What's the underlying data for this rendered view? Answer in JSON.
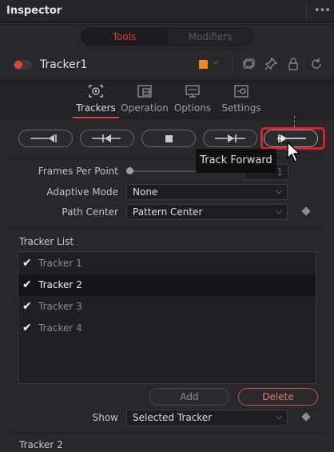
{
  "header": {
    "title": "Inspector",
    "menu_icon": "more-dots-icon"
  },
  "mode_toggle": {
    "tools_label": "Tools",
    "modifiers_label": "Modifiers",
    "selected": "Tools"
  },
  "node": {
    "name": "Tracker1",
    "enabled": true,
    "color": "#f08a1d"
  },
  "tabs": [
    {
      "label": "Trackers",
      "icon": "tracker-target-icon",
      "active": true
    },
    {
      "label": "Operation",
      "icon": "operation-icon",
      "active": false
    },
    {
      "label": "Options",
      "icon": "options-monitor-icon",
      "active": false
    },
    {
      "label": "Settings",
      "icon": "settings-icon",
      "active": false
    }
  ],
  "track_buttons": [
    {
      "icon": "track-to-start-icon"
    },
    {
      "icon": "track-backward-icon"
    },
    {
      "icon": "stop-tracking-icon"
    },
    {
      "icon": "track-forward-step-icon"
    },
    {
      "icon": "track-forward-icon",
      "highlighted": true
    }
  ],
  "tooltip": {
    "text": "Track Forward"
  },
  "params": {
    "frames_per_point": {
      "label": "Frames Per Point",
      "value": "1"
    },
    "adaptive_mode": {
      "label": "Adaptive Mode",
      "value": "None"
    },
    "path_center": {
      "label": "Path Center",
      "value": "Pattern Center"
    }
  },
  "tracker_list": {
    "label": "Tracker List",
    "items": [
      {
        "name": "Tracker 1",
        "checked": true,
        "selected": false
      },
      {
        "name": "Tracker 2",
        "checked": true,
        "selected": true
      },
      {
        "name": "Tracker 3",
        "checked": true,
        "selected": false
      },
      {
        "name": "Tracker 4",
        "checked": true,
        "selected": false
      }
    ]
  },
  "buttons": {
    "add": "Add",
    "delete": "Delete"
  },
  "show": {
    "label": "Show",
    "value": "Selected Tracker"
  },
  "footer": {
    "section_label": "Tracker 2"
  },
  "colors": {
    "accent_red": "#e0413a",
    "highlight_red": "#d8222c",
    "panel_bg": "#28282a"
  }
}
